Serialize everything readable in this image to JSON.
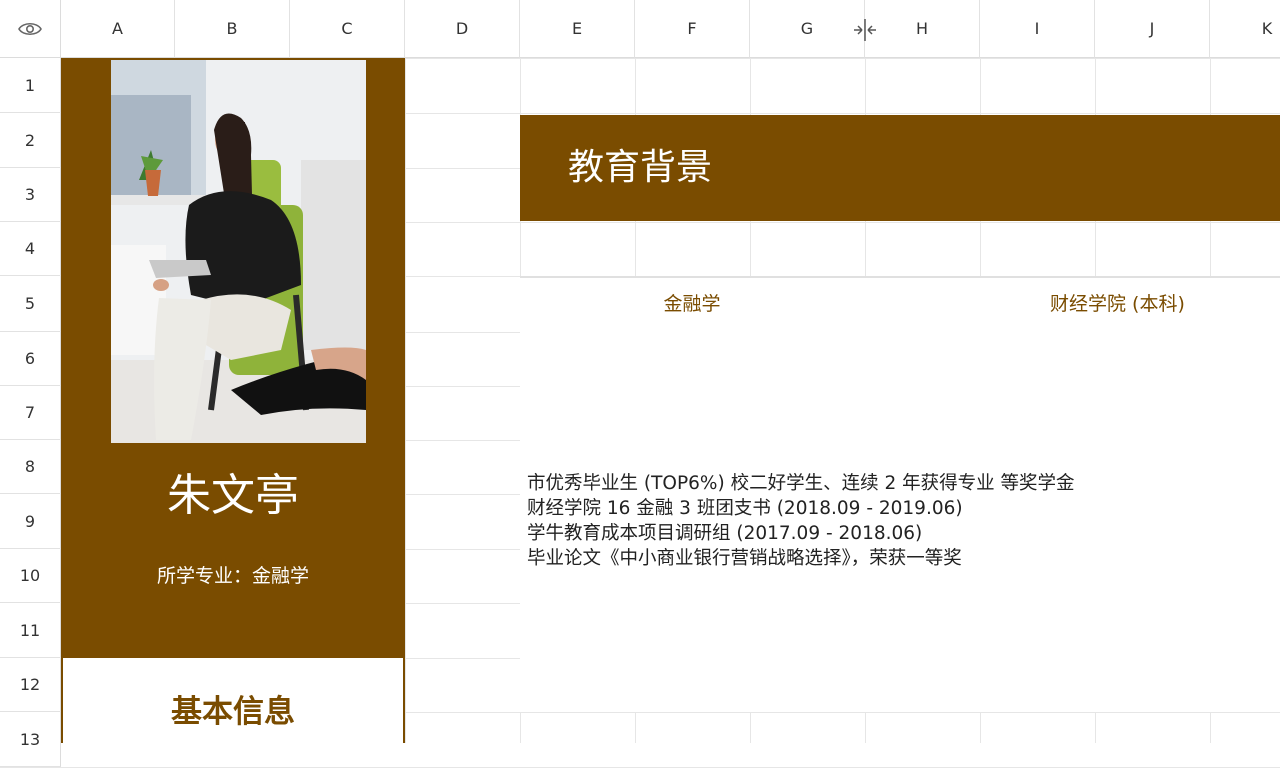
{
  "sheet": {
    "columns": [
      "A",
      "B",
      "C",
      "D",
      "E",
      "F",
      "G",
      "H",
      "I",
      "J",
      "K"
    ],
    "rows": [
      "1",
      "2",
      "3",
      "4",
      "5",
      "6",
      "7",
      "8",
      "9",
      "10",
      "11",
      "12",
      "13"
    ],
    "corner_icon": "eye-icon",
    "resize_icon": "column-resize-icon"
  },
  "profile": {
    "name": "朱文亭",
    "major_line": "所学专业：金融学",
    "photo": "profile-photo"
  },
  "education": {
    "section_title": "教育背景",
    "major": "金融学",
    "school": "财经学院 (本科)",
    "details": [
      "市优秀毕业生 (TOP6%) 校二好学生、连续 2 年获得专业 等奖学金",
      "财经学院 16 金融 3 班团支书 (2018.09 - 2019.06)",
      "学牛教育成本项目调研组 (2017.09 - 2018.06)",
      "毕业论文《中小商业银行营销战略选择》，荣获一等奖"
    ]
  },
  "basic_info": {
    "title": "基本信息"
  },
  "colors": {
    "accent": "#7a4c00",
    "grid": "#e6e6e6"
  }
}
